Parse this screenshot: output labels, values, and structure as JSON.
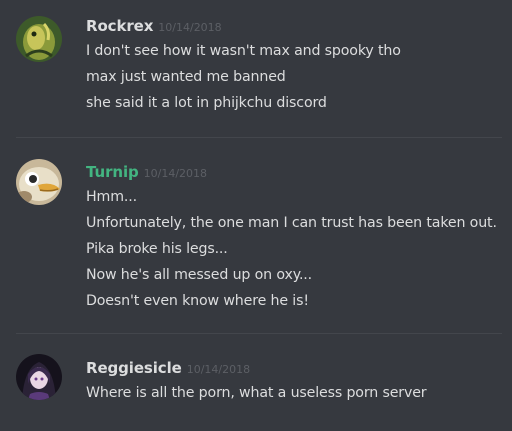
{
  "messages": [
    {
      "username": "Rockrex",
      "username_color": "#dcddde",
      "timestamp": "10/14/2018",
      "lines": [
        "I don't see how it wasn't max and spooky tho",
        "max just wanted me banned",
        "she said it a lot in phijkchu discord"
      ]
    },
    {
      "username": "Turnip",
      "username_color": "#43b581",
      "timestamp": "10/14/2018",
      "lines": [
        "Hmm...",
        "Unfortunately, the one man I can trust has been taken out.",
        "Pika broke his legs...",
        "Now he's all messed up on oxy...",
        "Doesn't even know where he is!"
      ]
    },
    {
      "username": "Reggiesicle",
      "username_color": "#dcddde",
      "timestamp": "10/14/2018",
      "lines": [
        "Where is all the porn, what a useless porn server"
      ]
    }
  ],
  "colors": {
    "background": "#36393f",
    "text": "#dcddde",
    "timestamp": "#5c5f65",
    "divider": "#43464c"
  }
}
